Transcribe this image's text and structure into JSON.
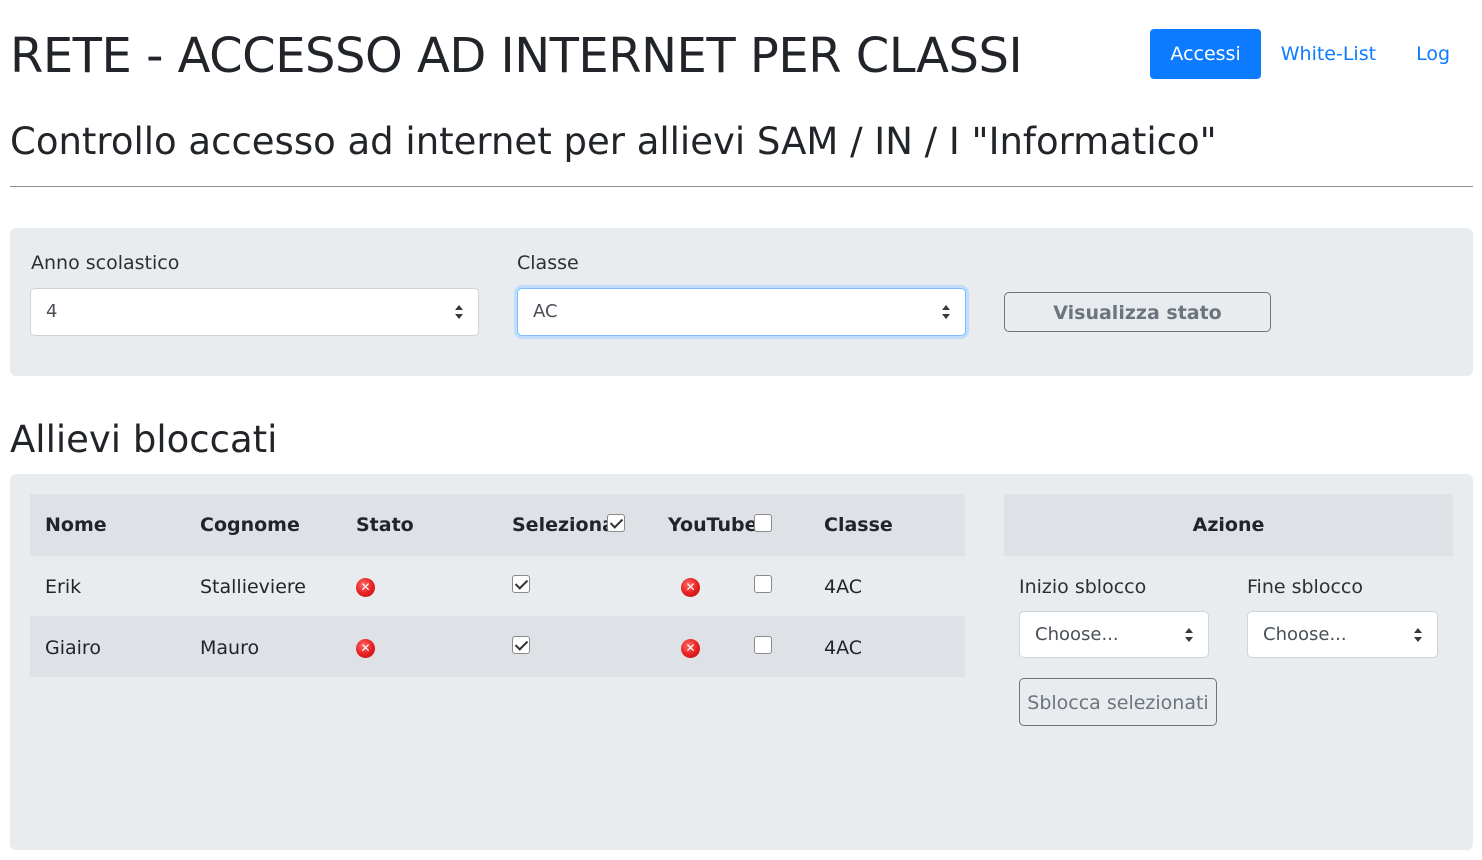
{
  "header": {
    "title": "RETE - ACCESSO AD INTERNET PER CLASSI",
    "nav": [
      "Accessi",
      "White-List",
      "Log"
    ],
    "active_nav": "Accessi",
    "subtitle": "Controllo accesso ad internet per allievi SAM / IN / I \"Informatico\""
  },
  "filter": {
    "anno_label": "Anno scolastico",
    "anno_value": "4",
    "classe_label": "Classe",
    "classe_value": "AC",
    "button": "Visualizza stato"
  },
  "blocked": {
    "heading": "Allievi bloccati",
    "columns": [
      "Nome",
      "Cognome",
      "Stato",
      "Seleziona",
      "YouTube",
      "Classe"
    ],
    "header_checks": {
      "seleziona": true,
      "youtube": false
    },
    "rows": [
      {
        "nome": "Erik",
        "cognome": "Stallieviere",
        "stato": "blocked-icon",
        "seleziona": true,
        "youtube_status": "blocked-icon",
        "youtube_checked": false,
        "classe": "4AC"
      },
      {
        "nome": "Giairo",
        "cognome": "Mauro",
        "stato": "blocked-icon",
        "seleziona": true,
        "youtube_status": "blocked-icon",
        "youtube_checked": false,
        "classe": "4AC"
      }
    ]
  },
  "azione": {
    "title": "Azione",
    "inizio_label": "Inizio sblocco",
    "inizio_placeholder": "Choose...",
    "fine_label": "Fine sblocco",
    "fine_placeholder": "Choose...",
    "button": "Sblocca selezionati"
  },
  "colors": {
    "primary": "#0d7bff",
    "panel": "#e9ecef",
    "stripe": "#dee2e6",
    "danger": "#e51e1e"
  }
}
